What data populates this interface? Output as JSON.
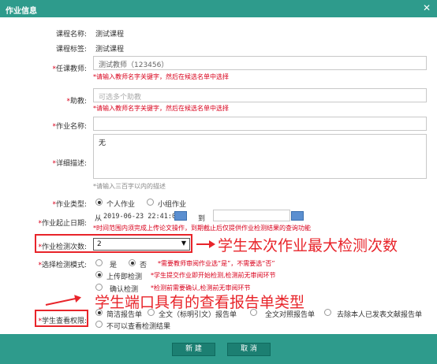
{
  "dialog": {
    "title": "作业信息"
  },
  "fields": {
    "course_name": {
      "label": "课程名称:",
      "value": "测试课程"
    },
    "course_tag": {
      "label": "课程标签:",
      "value": "测试课程"
    },
    "teacher": {
      "label": "任课教师:",
      "value": "测试教师（123456）",
      "hint": "*请输入教师名字关键字，然后在候选名单中选择"
    },
    "assistant": {
      "label": "助教:",
      "placeholder": "可选多个助教",
      "hint": "*请输入教师名字关键字，然后在候选名单中选择"
    },
    "homework_name": {
      "label": "作业名称:",
      "value": ""
    },
    "description": {
      "label": "详细描述:",
      "value": "无",
      "hint": "*请输入三百字以内的描述"
    },
    "homework_type": {
      "label": "作业类型:",
      "options": [
        "个人作业",
        "小组作业"
      ],
      "selected": "个人作业"
    },
    "date_range": {
      "label": "作业起止日期:",
      "from_label": "从",
      "from_value": "2019-06-23 22:41:00",
      "to_label": "到",
      "to_value": "",
      "hint": "*时间范围内须完成上传论文操作，到期截止后仅提供作业检测结果的查询功能"
    },
    "check_count": {
      "label": "作业检测次数:",
      "value": "2"
    },
    "check_mode": {
      "label": "选择检测模式:",
      "review_options": [
        "是",
        "否"
      ],
      "review_selected": "否",
      "review_hint": "*需要教师审阅作业选“是”，不需要选“否”",
      "mode_options": [
        "上传即检测",
        "确认检测"
      ],
      "mode_selected": "上传即检测",
      "upload_hint": "*学生提交作业即开始检测,检测前无审阅环节",
      "confirm_hint": "*检测前需要确认,检测前无审阅环节"
    },
    "student_permission": {
      "label": "学生查看权限:",
      "options": [
        "简洁报告单",
        "全文（标明引文）报告单",
        "全文对照报告单",
        "去除本人已发表文献报告单",
        "不可以查看检测结果"
      ],
      "selected": "简洁报告单"
    }
  },
  "annotations": {
    "check_count_note": "学生本次作业最大检测次数",
    "permission_note": "学生端口具有的查看报告单类型"
  },
  "buttons": {
    "create": "新 建",
    "cancel": "取 消"
  },
  "colors": {
    "header": "#2e9b8c",
    "required": "#d9001b",
    "annotation": "#e8242a"
  }
}
